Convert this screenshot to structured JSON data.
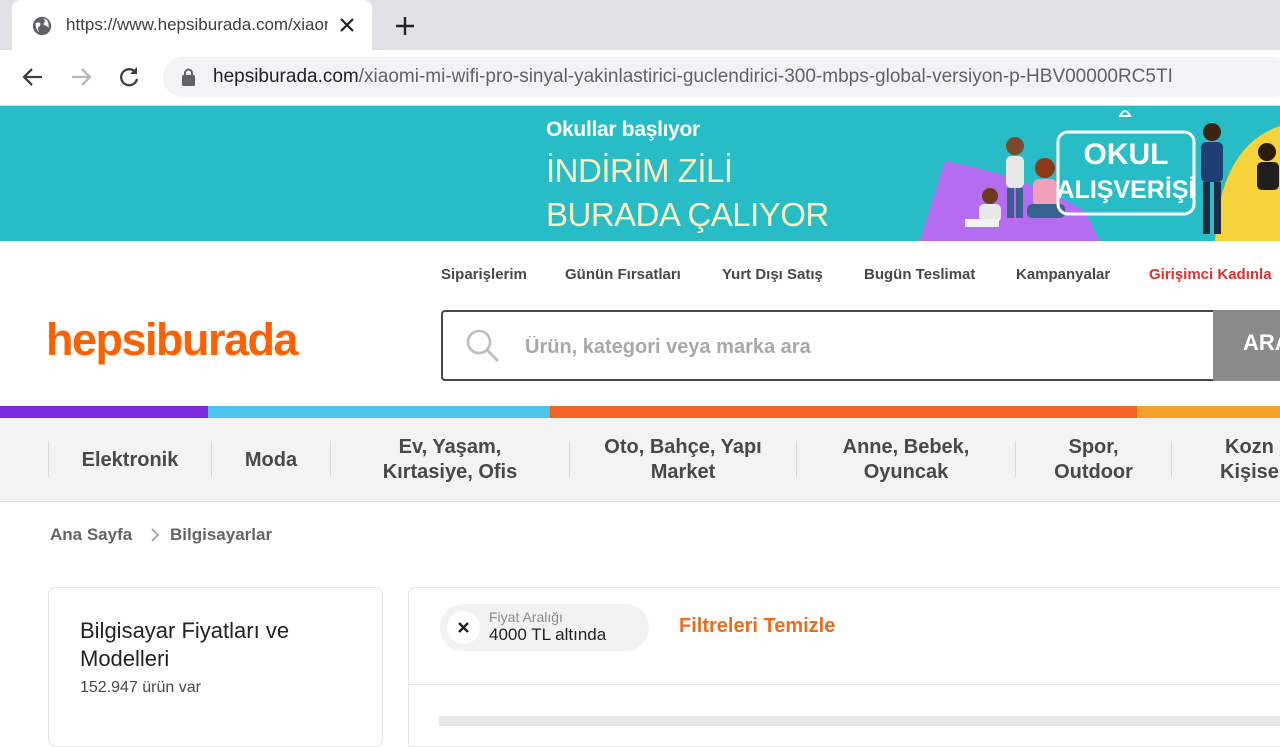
{
  "browser": {
    "tab_title": "https://www.hepsiburada.com/xiaomi",
    "url_domain": "hepsiburada.com",
    "url_path": "/xiaomi-mi-wifi-pro-sinyal-yakinlastirici-guclendirici-300-mbps-global-versiyon-p-HBV00000RC5TI"
  },
  "banner": {
    "line1": "Okullar başlıyor",
    "line2": "İNDİRİM ZİLİ",
    "line3": "BURADA ÇALIYOR",
    "badge_line1": "OKUL",
    "badge_line2": "ALIŞVERİŞİ"
  },
  "header": {
    "top_links": [
      "Siparişlerim",
      "Günün Fırsatları",
      "Yurt Dışı Satış",
      "Bugün Teslimat",
      "Kampanyalar",
      "Girişimci Kadınla"
    ],
    "logo": "hepsiburada",
    "search_placeholder": "Ürün, kategori veya marka ara",
    "search_button": "ARA"
  },
  "colors": {
    "brand_orange": "#ff6000",
    "banner_teal": "#27bcc6",
    "colorbar": [
      "#7b2ae0",
      "#4bc5ec",
      "#f16423",
      "#f7a128"
    ],
    "top_link_highlight": "#e62e2e"
  },
  "categories": [
    {
      "label_1": "Elektronik",
      "label_2": ""
    },
    {
      "label_1": "Moda",
      "label_2": ""
    },
    {
      "label_1": "Ev, Yaşam,",
      "label_2": "Kırtasiye, Ofis"
    },
    {
      "label_1": "Oto, Bahçe, Yapı",
      "label_2": "Market"
    },
    {
      "label_1": "Anne, Bebek,",
      "label_2": "Oyuncak"
    },
    {
      "label_1": "Spor,",
      "label_2": "Outdoor"
    },
    {
      "label_1": "Kozn",
      "label_2": "Kişise"
    }
  ],
  "breadcrumb": [
    "Ana Sayfa",
    "Bilgisayarlar"
  ],
  "sidebar": {
    "title": "Bilgisayar Fiyatları ve Modelleri",
    "count": "152.947 ürün var"
  },
  "filters": {
    "chip_label": "Fiyat Aralığı",
    "chip_value": "4000 TL altında",
    "clear_all": "Filtreleri Temizle"
  }
}
